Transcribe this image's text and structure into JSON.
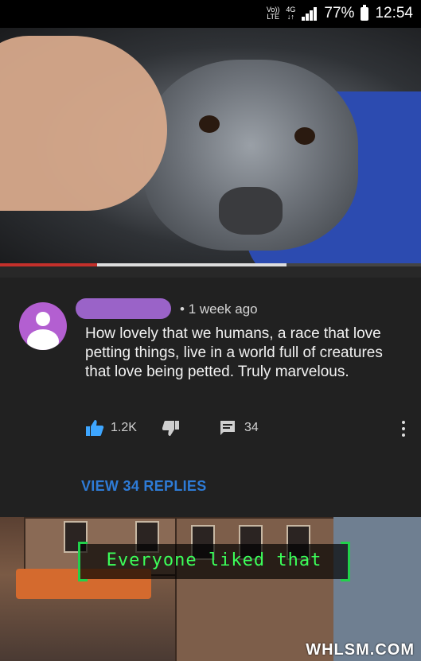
{
  "status_bar": {
    "volte_top": "Vo))",
    "volte_bottom": "LTE",
    "network_top": "4G",
    "network_bottom": "↓↑",
    "battery": "77%",
    "time": "12:54"
  },
  "video": {
    "progress_played_fraction": 0.23,
    "progress_buffered_fraction": 0.68
  },
  "comment": {
    "timestamp": "1 week ago",
    "text": "How lovely that we humans, a race that love petting things, live in a world full of creatures that love being petted. Truly marvelous.",
    "likes": "1.2K",
    "replies_count": "34"
  },
  "view_replies_label": "VIEW 34 REPLIES",
  "game_overlay": {
    "text": "Everyone liked that"
  },
  "watermark": "WHLSM.COM",
  "colors": {
    "progress_red": "#c4302b",
    "link_blue": "#2e7bd6",
    "like_blue": "#3ea6ff",
    "overlay_green": "#3cff5a",
    "avatar_purple": "#b35fd1"
  }
}
